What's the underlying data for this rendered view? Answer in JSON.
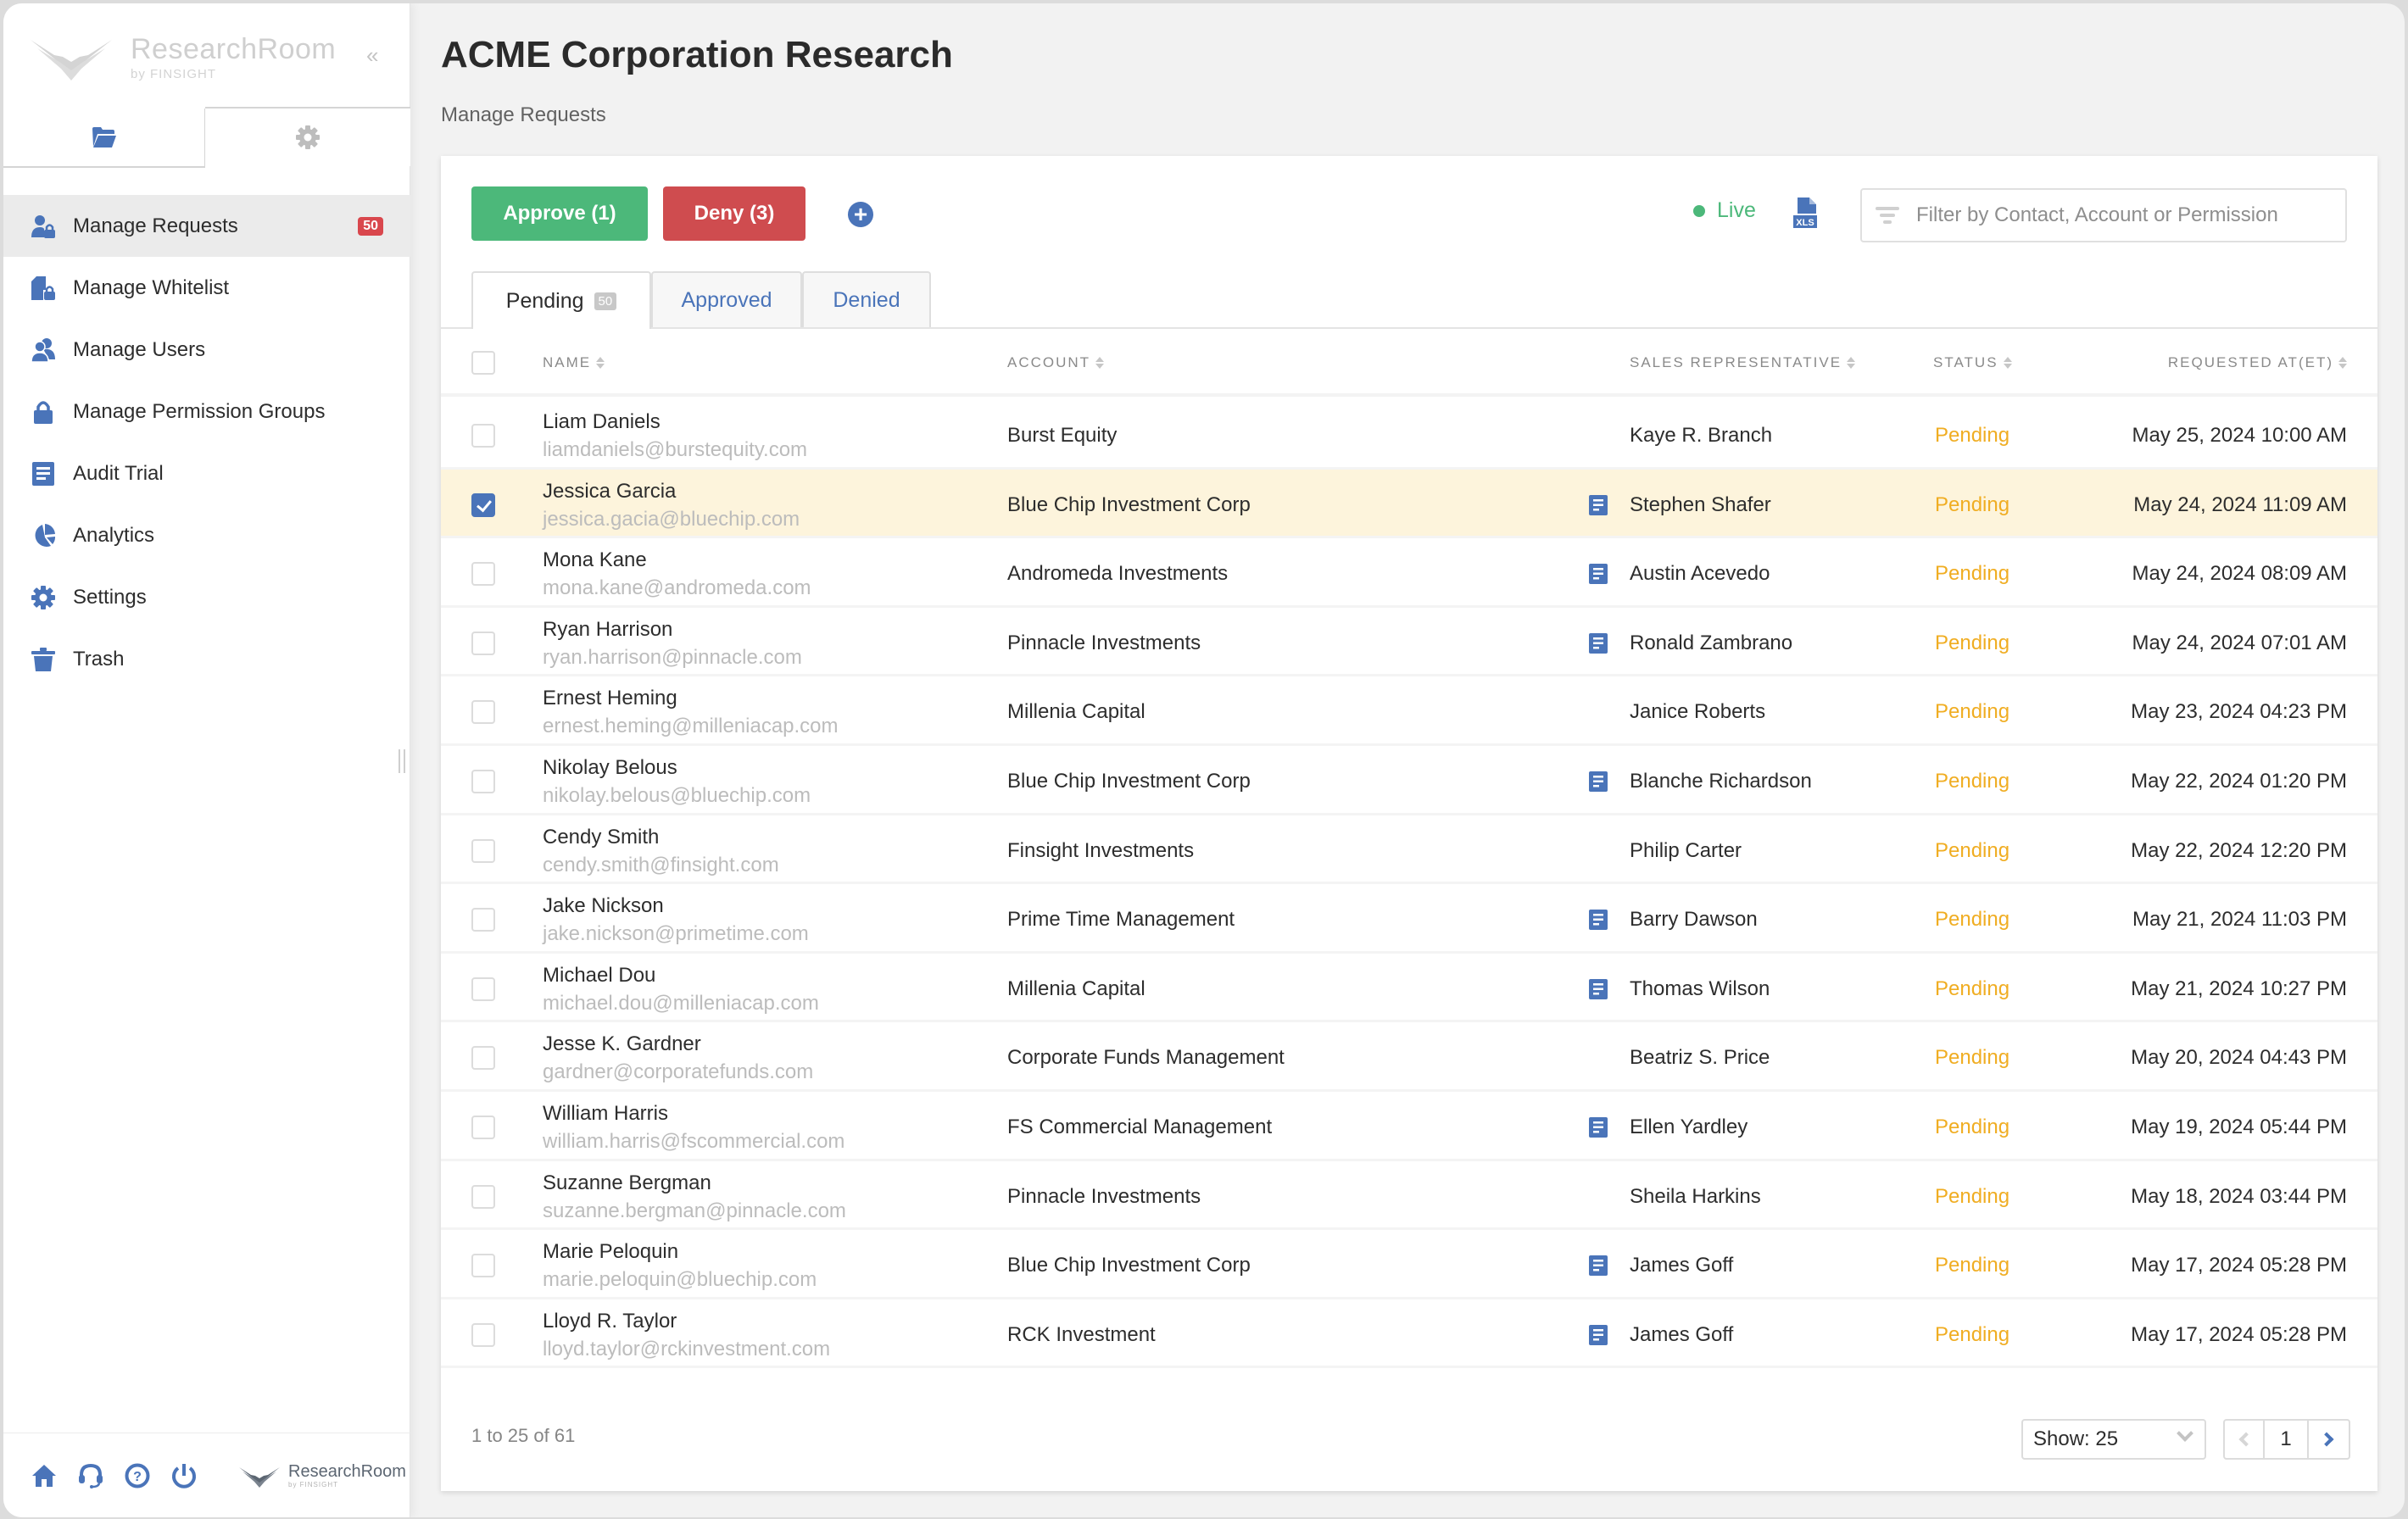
{
  "app": {
    "logo_title": "ResearchRoom",
    "logo_subtitle": "by FINSIGHT",
    "collapse_label": "«"
  },
  "sidebar": {
    "tabs": [
      {
        "icon": "folder-icon",
        "active": true
      },
      {
        "icon": "gear-icon",
        "active": false
      }
    ],
    "items": [
      {
        "label": "Manage Requests",
        "icon": "user-lock-icon",
        "badge": "50",
        "active": true
      },
      {
        "label": "Manage Whitelist",
        "icon": "file-lock-icon"
      },
      {
        "label": "Manage Users",
        "icon": "users-icon"
      },
      {
        "label": "Manage Permission Groups",
        "icon": "lock-icon"
      },
      {
        "label": "Audit Trial",
        "icon": "document-icon"
      },
      {
        "label": "Analytics",
        "icon": "pie-chart-icon"
      },
      {
        "label": "Settings",
        "icon": "gear-icon"
      },
      {
        "label": "Trash",
        "icon": "trash-icon"
      }
    ],
    "footer": {
      "icons": [
        "home-icon",
        "headset-icon",
        "help-icon",
        "power-icon"
      ],
      "logo_title": "ResearchRoom",
      "logo_subtitle": "by FINSIGHT"
    }
  },
  "header": {
    "title": "ACME Corporation Research",
    "breadcrumb": "Manage Requests"
  },
  "toolbar": {
    "approve_label": "Approve (1)",
    "deny_label": "Deny (3)",
    "add_label": "+",
    "live_label": "Live",
    "export_label": "XLS",
    "filter_placeholder": "Filter by Contact, Account or Permission",
    "filter_value": ""
  },
  "tabs": [
    {
      "label": "Pending",
      "badge": "50",
      "active": true
    },
    {
      "label": "Approved"
    },
    {
      "label": "Denied"
    }
  ],
  "table": {
    "columns": [
      "NAME",
      "ACCOUNT",
      "SALES REPRESENTATIVE",
      "STATUS",
      "REQUESTED AT(ET)"
    ],
    "rows": [
      {
        "name": "Liam Daniels",
        "email": "liamdaniels@burstequity.com",
        "account": "Burst Equity",
        "has_note": false,
        "rep": "Kaye R. Branch",
        "status": "Pending",
        "requested": "May 25, 2024 10:00 AM",
        "checked": false
      },
      {
        "name": "Jessica Garcia",
        "email": "jessica.gacia@bluechip.com",
        "account": "Blue Chip Investment Corp",
        "has_note": true,
        "rep": "Stephen Shafer",
        "status": "Pending",
        "requested": "May 24, 2024 11:09 AM",
        "checked": true
      },
      {
        "name": "Mona Kane",
        "email": "mona.kane@andromeda.com",
        "account": "Andromeda Investments",
        "has_note": true,
        "rep": "Austin Acevedo",
        "status": "Pending",
        "requested": "May 24, 2024 08:09 AM",
        "checked": false
      },
      {
        "name": "Ryan Harrison",
        "email": "ryan.harrison@pinnacle.com",
        "account": "Pinnacle Investments",
        "has_note": true,
        "rep": "Ronald Zambrano",
        "status": "Pending",
        "requested": "May 24, 2024 07:01 AM",
        "checked": false
      },
      {
        "name": "Ernest Heming",
        "email": "ernest.heming@milleniacap.com",
        "account": "Millenia Capital",
        "has_note": false,
        "rep": "Janice Roberts",
        "status": "Pending",
        "requested": "May 23, 2024 04:23 PM",
        "checked": false
      },
      {
        "name": "Nikolay Belous",
        "email": "nikolay.belous@bluechip.com",
        "account": "Blue Chip Investment Corp",
        "has_note": true,
        "rep": "Blanche Richardson",
        "status": "Pending",
        "requested": "May 22, 2024 01:20 PM",
        "checked": false
      },
      {
        "name": "Cendy Smith",
        "email": "cendy.smith@finsight.com",
        "account": "Finsight Investments",
        "has_note": false,
        "rep": "Philip Carter",
        "status": "Pending",
        "requested": "May 22, 2024 12:20 PM",
        "checked": false
      },
      {
        "name": "Jake Nickson",
        "email": "jake.nickson@primetime.com",
        "account": "Prime Time Management",
        "has_note": true,
        "rep": "Barry Dawson",
        "status": "Pending",
        "requested": "May 21, 2024 11:03 PM",
        "checked": false
      },
      {
        "name": "Michael Dou",
        "email": "michael.dou@milleniacap.com",
        "account": "Millenia Capital",
        "has_note": true,
        "rep": "Thomas Wilson",
        "status": "Pending",
        "requested": "May 21, 2024 10:27 PM",
        "checked": false
      },
      {
        "name": "Jesse K. Gardner",
        "email": "gardner@corporatefunds.com",
        "account": "Corporate Funds Management",
        "has_note": false,
        "rep": "Beatriz S. Price",
        "status": "Pending",
        "requested": "May 20, 2024 04:43 PM",
        "checked": false
      },
      {
        "name": "William Harris",
        "email": "william.harris@fscommercial.com",
        "account": "FS Commercial Management",
        "has_note": true,
        "rep": "Ellen Yardley",
        "status": "Pending",
        "requested": "May 19, 2024 05:44 PM",
        "checked": false
      },
      {
        "name": "Suzanne Bergman",
        "email": "suzanne.bergman@pinnacle.com",
        "account": "Pinnacle Investments",
        "has_note": false,
        "rep": "Sheila Harkins",
        "status": "Pending",
        "requested": "May 18, 2024 03:44 PM",
        "checked": false
      },
      {
        "name": "Marie Peloquin",
        "email": "marie.peloquin@bluechip.com",
        "account": "Blue Chip Investment Corp",
        "has_note": true,
        "rep": "James Goff",
        "status": "Pending",
        "requested": "May 17, 2024 05:28 PM",
        "checked": false
      },
      {
        "name": "Lloyd R. Taylor",
        "email": "lloyd.taylor@rckinvestment.com",
        "account": "RCK Investment",
        "has_note": true,
        "rep": "James Goff",
        "status": "Pending",
        "requested": "May 17, 2024 05:28 PM",
        "checked": false
      }
    ]
  },
  "footer": {
    "count_text": "1 to 25 of 61",
    "show_label": "Show: 25",
    "current_page": "1"
  },
  "colors": {
    "accent": "#4a74b9",
    "approve": "#4cb87a",
    "deny": "#cf4c4f",
    "pending": "#f0ad22",
    "selected_row": "#fdf4dc"
  }
}
